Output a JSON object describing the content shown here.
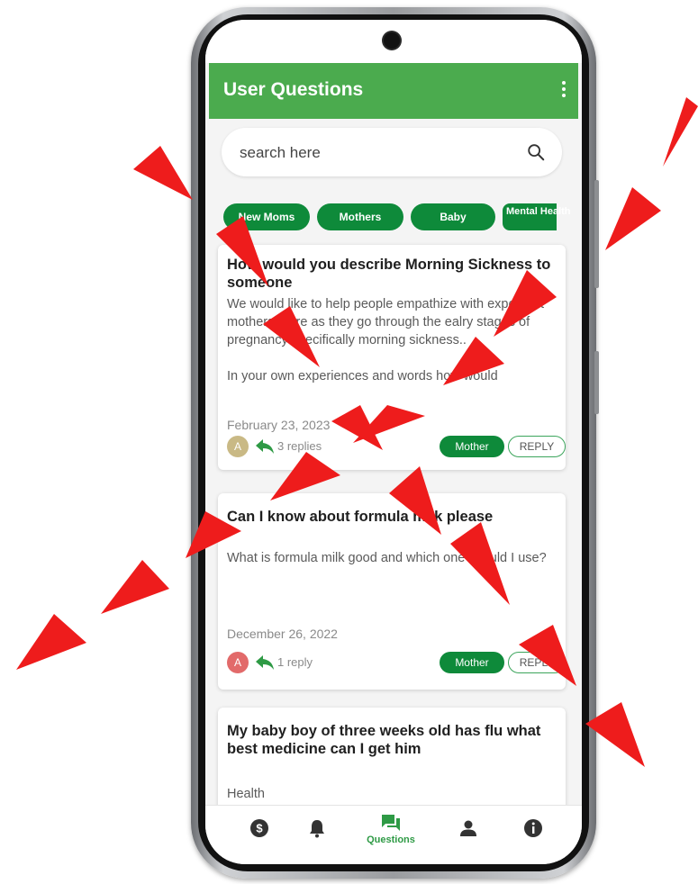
{
  "app_bar": {
    "title": "User Questions",
    "menu_icon": "more-vert-icon"
  },
  "search": {
    "placeholder": "search here",
    "icon": "search-icon"
  },
  "categories": [
    {
      "label": "New Moms"
    },
    {
      "label": "Mothers"
    },
    {
      "label": "Baby"
    },
    {
      "label": "Mental Health"
    }
  ],
  "questions": [
    {
      "title": "How would you describe Morning Sickness to someone",
      "body": "We would like to help people empathize with expectant mothers more as they go through the ealry stages of pregnancy specifically morning sickness..\n\nIn your own experiences and words how would",
      "date": "February 23, 2023",
      "avatar_letter": "A",
      "avatar_color": "#c9b985",
      "replies": "3 replies",
      "role": "Mother",
      "reply_label": "REPLY"
    },
    {
      "title": "Can I know about formula milk please",
      "body": "What is formula milk good and which one should I use?",
      "date": "December 26, 2022",
      "avatar_letter": "A",
      "avatar_color": "#e26a6a",
      "replies": "1 reply",
      "role": "Mother",
      "reply_label": "REPLY"
    },
    {
      "title": "My baby boy of three weeks old has flu what best medicine can I get him",
      "body": "Health"
    }
  ],
  "bottom_nav": [
    {
      "icon": "dollar-icon",
      "label": ""
    },
    {
      "icon": "bell-icon",
      "label": ""
    },
    {
      "icon": "chat-icon",
      "label": "Questions",
      "active": true
    },
    {
      "icon": "person-icon",
      "label": ""
    },
    {
      "icon": "info-icon",
      "label": ""
    }
  ],
  "colors": {
    "app_bar": "#4bab4e",
    "chip": "#0e8a3a",
    "nav_active": "#2e9a45",
    "arrow": "#ee1c1c"
  }
}
